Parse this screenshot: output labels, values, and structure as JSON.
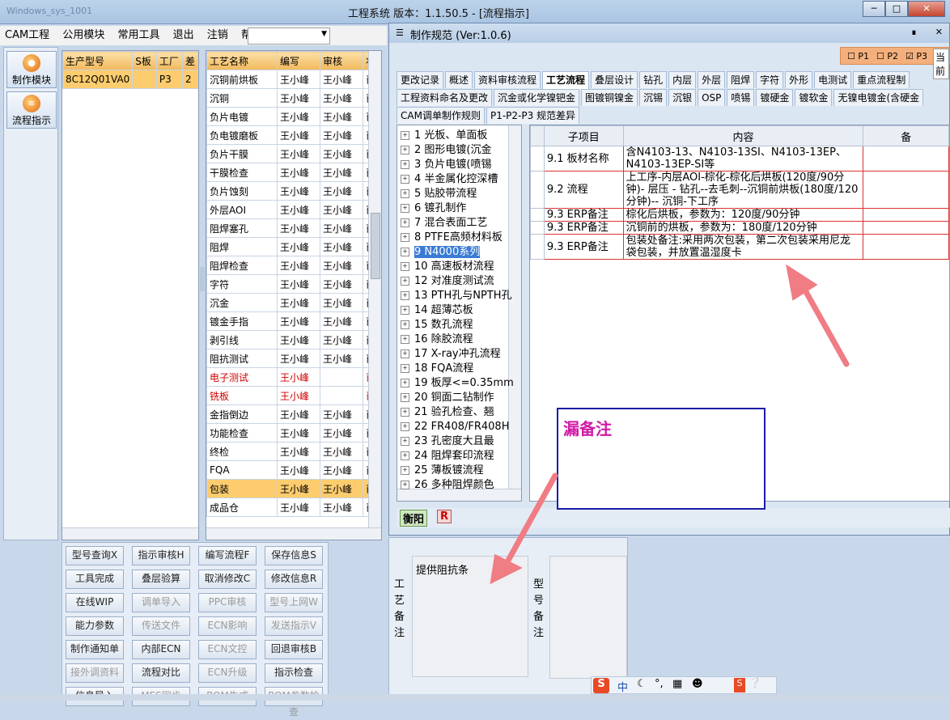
{
  "main_window": {
    "title": "工程系统  版本：1.1.50.5 - [流程指示]",
    "left_title": "Windows_sys_1001"
  },
  "menu": [
    "CAM工程",
    "公用模块",
    "常用工具",
    "退出",
    "注销",
    "帮助"
  ],
  "nav": [
    {
      "label": "制作模块",
      "icon": "fire-icon"
    },
    {
      "label": "流程指示",
      "icon": "flow-icon"
    }
  ],
  "model_grid": {
    "headers": [
      "生产型号",
      "S板",
      "工厂",
      "差"
    ],
    "rows": [
      [
        "8C12Q01VA0",
        "",
        "P3",
        "2"
      ]
    ]
  },
  "process_grid": {
    "headers": [
      "工艺名称",
      "编写",
      "审核",
      "状"
    ],
    "rows": [
      {
        "name": "沉铜前烘板",
        "writer": "王小峰",
        "reviewer": "王小峰",
        "s": "已",
        "style": ""
      },
      {
        "name": "沉铜",
        "writer": "王小峰",
        "reviewer": "王小峰",
        "s": "已",
        "style": ""
      },
      {
        "name": "负片电镀",
        "writer": "王小峰",
        "reviewer": "王小峰",
        "s": "已",
        "style": ""
      },
      {
        "name": "负电镀磨板",
        "writer": "王小峰",
        "reviewer": "王小峰",
        "s": "已",
        "style": ""
      },
      {
        "name": "负片干膜",
        "writer": "王小峰",
        "reviewer": "王小峰",
        "s": "已",
        "style": ""
      },
      {
        "name": "干膜检查",
        "writer": "王小峰",
        "reviewer": "王小峰",
        "s": "已",
        "style": ""
      },
      {
        "name": "负片蚀刻",
        "writer": "王小峰",
        "reviewer": "王小峰",
        "s": "已",
        "style": ""
      },
      {
        "name": "外层AOI",
        "writer": "王小峰",
        "reviewer": "王小峰",
        "s": "已",
        "style": ""
      },
      {
        "name": "阻焊塞孔",
        "writer": "王小峰",
        "reviewer": "王小峰",
        "s": "已",
        "style": ""
      },
      {
        "name": "阻焊",
        "writer": "王小峰",
        "reviewer": "王小峰",
        "s": "已",
        "style": ""
      },
      {
        "name": "阻焊检查",
        "writer": "王小峰",
        "reviewer": "王小峰",
        "s": "已",
        "style": ""
      },
      {
        "name": "字符",
        "writer": "王小峰",
        "reviewer": "王小峰",
        "s": "已",
        "style": ""
      },
      {
        "name": "沉金",
        "writer": "王小峰",
        "reviewer": "王小峰",
        "s": "已",
        "style": ""
      },
      {
        "name": "镀金手指",
        "writer": "王小峰",
        "reviewer": "王小峰",
        "s": "已",
        "style": ""
      },
      {
        "name": "剥引线",
        "writer": "王小峰",
        "reviewer": "王小峰",
        "s": "已",
        "style": ""
      },
      {
        "name": "阻抗测试",
        "writer": "王小峰",
        "reviewer": "王小峰",
        "s": "已",
        "style": ""
      },
      {
        "name": "电子测试",
        "writer": "王小峰",
        "reviewer": "",
        "s": "已",
        "style": "red"
      },
      {
        "name": "铣板",
        "writer": "王小峰",
        "reviewer": "",
        "s": "已",
        "style": "red"
      },
      {
        "name": "金指倒边",
        "writer": "王小峰",
        "reviewer": "王小峰",
        "s": "已",
        "style": ""
      },
      {
        "name": "功能检查",
        "writer": "王小峰",
        "reviewer": "王小峰",
        "s": "已",
        "style": ""
      },
      {
        "name": "终检",
        "writer": "王小峰",
        "reviewer": "王小峰",
        "s": "已",
        "style": ""
      },
      {
        "name": "FQA",
        "writer": "王小峰",
        "reviewer": "王小峰",
        "s": "已",
        "style": ""
      },
      {
        "name": "包装",
        "writer": "王小峰",
        "reviewer": "王小峰",
        "s": "已",
        "style": "sel"
      },
      {
        "name": "成品仓",
        "writer": "王小峰",
        "reviewer": "王小峰",
        "s": "已",
        "style": ""
      }
    ]
  },
  "buttons": [
    [
      "型号查询X",
      "指示审核H",
      "编写流程F",
      "保存信息S"
    ],
    [
      "工具完成",
      "叠层验算",
      "取消修改C",
      "修改信息R"
    ],
    [
      "在线WIP",
      "调单导入",
      "PPC审核",
      "型号上网W"
    ],
    [
      "能力参数",
      "传送文件",
      "ECN影响",
      "发送指示V"
    ],
    [
      "制作通知单",
      "内部ECN",
      "ECN文控",
      "回退审核B"
    ],
    [
      "接外调资料",
      "流程对比",
      "ECN升级",
      "指示检查"
    ],
    [
      "信息导入",
      "MES同步",
      "BOM生成",
      "BOM参数检查"
    ]
  ],
  "disabled_buttons": [
    "调单导入",
    "PPC审核",
    "型号上网W",
    "传送文件",
    "ECN影响",
    "发送指示V",
    "ECN文控",
    "接外调资料",
    "ECN升级",
    "MES同步",
    "BOM生成",
    "BOM参数检查"
  ],
  "dialog": {
    "title": "制作规范 (Ver:1.0.6)",
    "p_checks": [
      {
        "label": "P1",
        "checked": false
      },
      {
        "label": "P2",
        "checked": false
      },
      {
        "label": "P3",
        "checked": true
      }
    ],
    "p_button": "当前",
    "tabs_row1": [
      "更改记录",
      "概述",
      "资料审核流程",
      "工艺流程",
      "叠层设计",
      "钻孔",
      "内层",
      "外层",
      "阻焊",
      "字符",
      "外形",
      "电测试",
      "重点流程制"
    ],
    "tabs_row2": [
      "工程资料命名及更改",
      "沉金或化学镍钯金",
      "图镀铜镍金",
      "沉锡",
      "沉银",
      "OSP",
      "喷锡",
      "镀硬金",
      "镀软金",
      "无镍电镀金(含硬金"
    ],
    "tabs_row3": [
      "CAM调单制作规则",
      "P1-P2-P3 规范差异"
    ],
    "active_tab": "工艺流程",
    "tree": [
      "1 光板、单面板",
      "2 图形电镀(沉金",
      "3 负片电镀(喷锡",
      "4 半金属化控深槽",
      "5 贴胶带流程",
      "6 镀孔制作",
      "7 混合表面工艺",
      "8 PTFE高频材料板",
      "9 N4000系列",
      "10 高速板材流程",
      "12 对准度测试流",
      "13 PTH孔与NPTH孔",
      "14 超薄芯板",
      "15 数孔流程",
      "16 除胶流程",
      "17 X-ray冲孔流程",
      "18 FQA流程",
      "19 板厚<=0.35mm",
      "20 铜面二钻制作",
      "21 验孔检查、翘",
      "22 FR408/FR408H",
      "23 孔密度大且最",
      "24 阻焊套印流程",
      "25 薄板镀流程",
      "26 多种阻焊颜色"
    ],
    "tree_selected": "9 N4000系列",
    "content_headers": [
      "子项目",
      "内容",
      "备"
    ],
    "content_rows": [
      {
        "item": "9.1 板材名称",
        "content": "含N4103-13、N4103-13SI、N4103-13EP、N4103-13EP-SI等"
      },
      {
        "item": "9.2 流程",
        "content": "上工序-内层AOI-棕化-棕化后烘板(120度/90分钟)- 层压 - 钻孔--去毛刺--沉铜前烘板(180度/120分钟)-- 沉铜-下工序"
      },
      {
        "item": "9.3 ERP备注",
        "content": "棕化后烘板，参数为：120度/90分钟"
      },
      {
        "item": "9.3 ERP备注",
        "content": "沉铜前的烘板，参数为：180度/120分钟"
      },
      {
        "item": "9.3 ERP备注",
        "content": "包装处备注:采用两次包装，第二次包装采用尼龙袋包装，并放置温湿度卡"
      }
    ],
    "footer_tags": [
      "衡阳",
      "R"
    ]
  },
  "annotation": "漏备注",
  "notes": {
    "process_label": "工艺备注",
    "process_value": "提供阻抗条",
    "model_label": "型号备注"
  },
  "ime": {
    "badge": "S",
    "text": "中"
  },
  "colors": {
    "accent": "#f5b74d",
    "annotation_text": "#d01aa6",
    "annotation_border": "#1c1ca8",
    "arrow": "#f07c84"
  }
}
